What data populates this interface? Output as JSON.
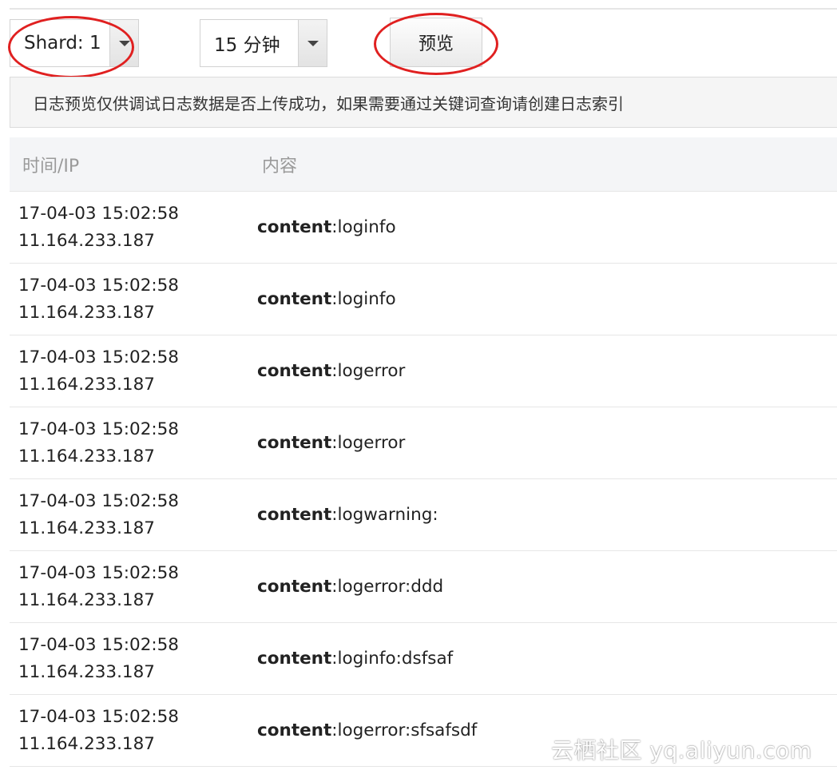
{
  "toolbar": {
    "shard_select_value": "Shard: 1",
    "time_select_value": "15 分钟",
    "preview_label": "预览"
  },
  "notice": "日志预览仅供调试日志数据是否上传成功，如果需要通过关键词查询请创建日志索引",
  "table": {
    "headers": {
      "time_ip": "时间/IP",
      "content": "内容"
    },
    "rows": [
      {
        "time": "17-04-03 15:02:58",
        "ip": "11.164.233.187",
        "key": "content",
        "value": ":loginfo"
      },
      {
        "time": "17-04-03 15:02:58",
        "ip": "11.164.233.187",
        "key": "content",
        "value": ":loginfo"
      },
      {
        "time": "17-04-03 15:02:58",
        "ip": "11.164.233.187",
        "key": "content",
        "value": ":logerror"
      },
      {
        "time": "17-04-03 15:02:58",
        "ip": "11.164.233.187",
        "key": "content",
        "value": ":logerror"
      },
      {
        "time": "17-04-03 15:02:58",
        "ip": "11.164.233.187",
        "key": "content",
        "value": ":logwarning:"
      },
      {
        "time": "17-04-03 15:02:58",
        "ip": "11.164.233.187",
        "key": "content",
        "value": ":logerror:ddd"
      },
      {
        "time": "17-04-03 15:02:58",
        "ip": "11.164.233.187",
        "key": "content",
        "value": ":loginfo:dsfsaf"
      },
      {
        "time": "17-04-03 15:02:58",
        "ip": "11.164.233.187",
        "key": "content",
        "value": ":logerror:sfsafsdf"
      }
    ]
  },
  "watermark": "云栖社区 yq.aliyun.com",
  "colors": {
    "annotation": "#e02020",
    "header_bg": "#f4f5f7",
    "notice_bg": "#f5f5f5"
  }
}
